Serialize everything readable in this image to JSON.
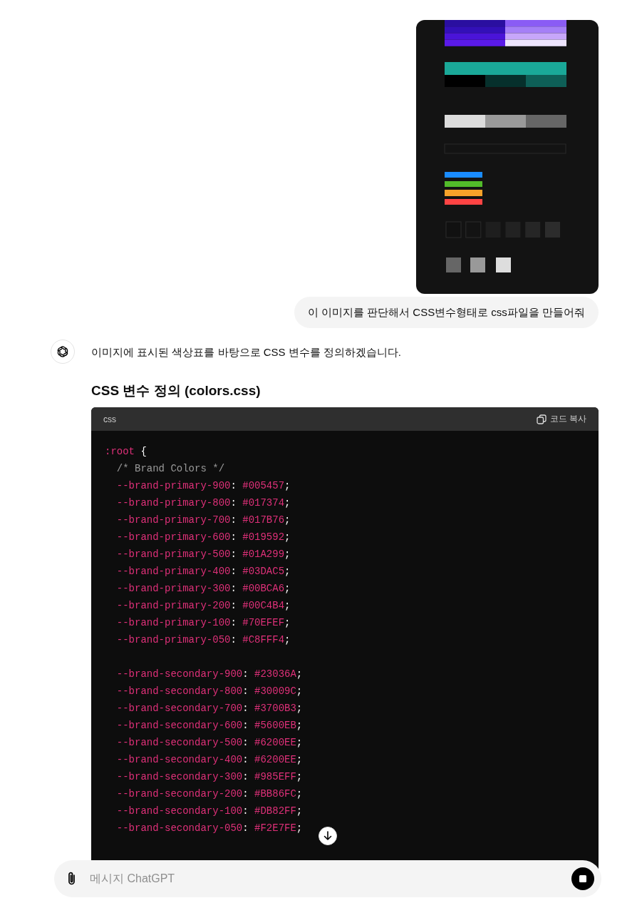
{
  "user_message": {
    "text": "이 이미지를 판단해서 CSS변수형태로 css파일을 만들어줘"
  },
  "assistant_message": {
    "text": "이미지에 표시된 색상표를 바탕으로 CSS 변수를 정의하겠습니다.",
    "heading": "CSS 변수 정의 (colors.css)",
    "code_block": {
      "language": "css",
      "copy_label": "코드 복사",
      "lines": [
        {
          "kind": "code",
          "tokens": [
            {
              "kind": "selector",
              "text": ":root"
            },
            {
              "kind": "plain",
              "text": " {"
            }
          ]
        },
        {
          "kind": "code",
          "tokens": [
            {
              "kind": "comment",
              "text": "  /* Brand Colors */"
            }
          ]
        },
        {
          "kind": "code",
          "tokens": [
            {
              "kind": "property",
              "text": "  --brand-primary-900"
            },
            {
              "kind": "plain",
              "text": ": "
            },
            {
              "kind": "value",
              "text": "#005457"
            },
            {
              "kind": "plain",
              "text": ";"
            }
          ]
        },
        {
          "kind": "code",
          "tokens": [
            {
              "kind": "property",
              "text": "  --brand-primary-800"
            },
            {
              "kind": "plain",
              "text": ": "
            },
            {
              "kind": "value",
              "text": "#017374"
            },
            {
              "kind": "plain",
              "text": ";"
            }
          ]
        },
        {
          "kind": "code",
          "tokens": [
            {
              "kind": "property",
              "text": "  --brand-primary-700"
            },
            {
              "kind": "plain",
              "text": ": "
            },
            {
              "kind": "value",
              "text": "#017B76"
            },
            {
              "kind": "plain",
              "text": ";"
            }
          ]
        },
        {
          "kind": "code",
          "tokens": [
            {
              "kind": "property",
              "text": "  --brand-primary-600"
            },
            {
              "kind": "plain",
              "text": ": "
            },
            {
              "kind": "value",
              "text": "#019592"
            },
            {
              "kind": "plain",
              "text": ";"
            }
          ]
        },
        {
          "kind": "code",
          "tokens": [
            {
              "kind": "property",
              "text": "  --brand-primary-500"
            },
            {
              "kind": "plain",
              "text": ": "
            },
            {
              "kind": "value",
              "text": "#01A299"
            },
            {
              "kind": "plain",
              "text": ";"
            }
          ]
        },
        {
          "kind": "code",
          "tokens": [
            {
              "kind": "property",
              "text": "  --brand-primary-400"
            },
            {
              "kind": "plain",
              "text": ": "
            },
            {
              "kind": "value",
              "text": "#03DAC5"
            },
            {
              "kind": "plain",
              "text": ";"
            }
          ]
        },
        {
          "kind": "code",
          "tokens": [
            {
              "kind": "property",
              "text": "  --brand-primary-300"
            },
            {
              "kind": "plain",
              "text": ": "
            },
            {
              "kind": "value",
              "text": "#00BCA6"
            },
            {
              "kind": "plain",
              "text": ";"
            }
          ]
        },
        {
          "kind": "code",
          "tokens": [
            {
              "kind": "property",
              "text": "  --brand-primary-200"
            },
            {
              "kind": "plain",
              "text": ": "
            },
            {
              "kind": "value",
              "text": "#00C4B4"
            },
            {
              "kind": "plain",
              "text": ";"
            }
          ]
        },
        {
          "kind": "code",
          "tokens": [
            {
              "kind": "property",
              "text": "  --brand-primary-100"
            },
            {
              "kind": "plain",
              "text": ": "
            },
            {
              "kind": "value",
              "text": "#70EFEF"
            },
            {
              "kind": "plain",
              "text": ";"
            }
          ]
        },
        {
          "kind": "code",
          "tokens": [
            {
              "kind": "property",
              "text": "  --brand-primary-050"
            },
            {
              "kind": "plain",
              "text": ": "
            },
            {
              "kind": "value",
              "text": "#C8FFF4"
            },
            {
              "kind": "plain",
              "text": ";"
            }
          ]
        },
        {
          "kind": "blank"
        },
        {
          "kind": "code",
          "tokens": [
            {
              "kind": "property",
              "text": "  --brand-secondary-900"
            },
            {
              "kind": "plain",
              "text": ": "
            },
            {
              "kind": "value",
              "text": "#23036A"
            },
            {
              "kind": "plain",
              "text": ";"
            }
          ]
        },
        {
          "kind": "code",
          "tokens": [
            {
              "kind": "property",
              "text": "  --brand-secondary-800"
            },
            {
              "kind": "plain",
              "text": ": "
            },
            {
              "kind": "value",
              "text": "#30009C"
            },
            {
              "kind": "plain",
              "text": ";"
            }
          ]
        },
        {
          "kind": "code",
          "tokens": [
            {
              "kind": "property",
              "text": "  --brand-secondary-700"
            },
            {
              "kind": "plain",
              "text": ": "
            },
            {
              "kind": "value",
              "text": "#3700B3"
            },
            {
              "kind": "plain",
              "text": ";"
            }
          ]
        },
        {
          "kind": "code",
          "tokens": [
            {
              "kind": "property",
              "text": "  --brand-secondary-600"
            },
            {
              "kind": "plain",
              "text": ": "
            },
            {
              "kind": "value",
              "text": "#5600EB"
            },
            {
              "kind": "plain",
              "text": ";"
            }
          ]
        },
        {
          "kind": "code",
          "tokens": [
            {
              "kind": "property",
              "text": "  --brand-secondary-500"
            },
            {
              "kind": "plain",
              "text": ": "
            },
            {
              "kind": "value",
              "text": "#6200EE"
            },
            {
              "kind": "plain",
              "text": ";"
            }
          ]
        },
        {
          "kind": "code",
          "tokens": [
            {
              "kind": "property",
              "text": "  --brand-secondary-400"
            },
            {
              "kind": "plain",
              "text": ": "
            },
            {
              "kind": "value",
              "text": "#6200EE"
            },
            {
              "kind": "plain",
              "text": ";"
            }
          ]
        },
        {
          "kind": "code",
          "tokens": [
            {
              "kind": "property",
              "text": "  --brand-secondary-300"
            },
            {
              "kind": "plain",
              "text": ": "
            },
            {
              "kind": "value",
              "text": "#985EFF"
            },
            {
              "kind": "plain",
              "text": ";"
            }
          ]
        },
        {
          "kind": "code",
          "tokens": [
            {
              "kind": "property",
              "text": "  --brand-secondary-200"
            },
            {
              "kind": "plain",
              "text": ": "
            },
            {
              "kind": "value",
              "text": "#BB86FC"
            },
            {
              "kind": "plain",
              "text": ";"
            }
          ]
        },
        {
          "kind": "code",
          "tokens": [
            {
              "kind": "property",
              "text": "  --brand-secondary-100"
            },
            {
              "kind": "plain",
              "text": ": "
            },
            {
              "kind": "value",
              "text": "#DB82FF"
            },
            {
              "kind": "plain",
              "text": ";"
            }
          ]
        },
        {
          "kind": "code",
          "tokens": [
            {
              "kind": "property",
              "text": "  --brand-secondary-050"
            },
            {
              "kind": "plain",
              "text": ": "
            },
            {
              "kind": "value",
              "text": "#F2E7FE"
            },
            {
              "kind": "plain",
              "text": ";"
            }
          ]
        },
        {
          "kind": "blank"
        }
      ]
    }
  },
  "composer": {
    "placeholder": "메시지 ChatGPT"
  }
}
